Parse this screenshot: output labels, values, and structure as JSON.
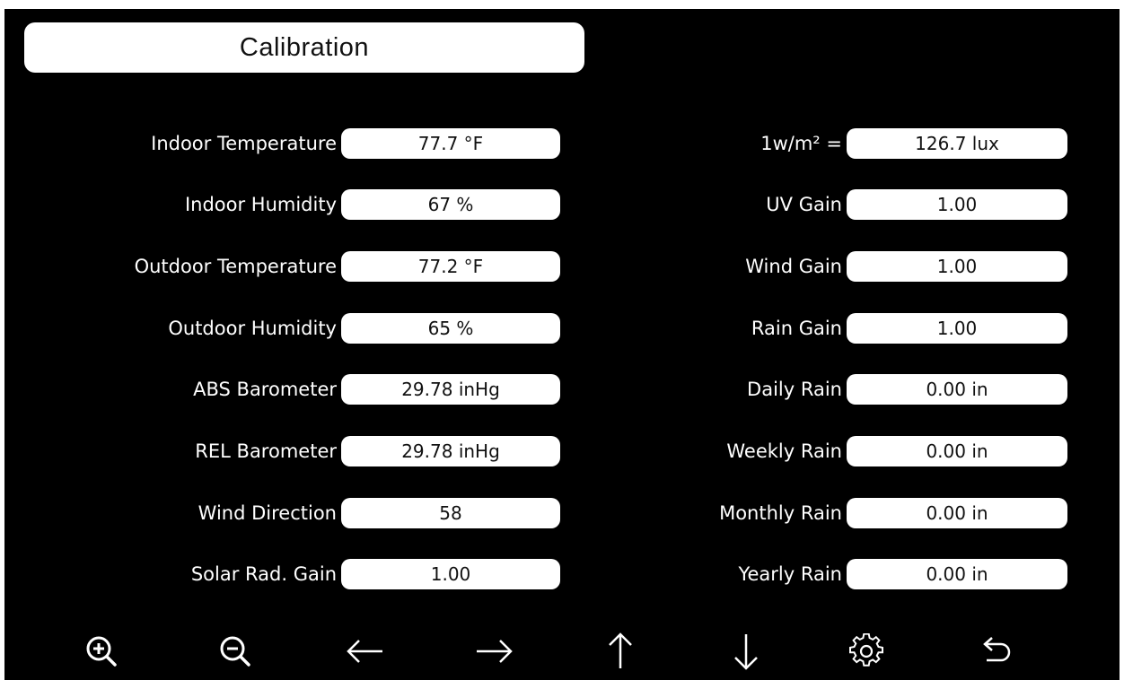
{
  "header": {
    "title": "Calibration"
  },
  "left_fields": [
    {
      "label": "Indoor Temperature",
      "value": "77.7 °F"
    },
    {
      "label": "Indoor Humidity",
      "value": "67 %"
    },
    {
      "label": "Outdoor Temperature",
      "value": "77.2 °F"
    },
    {
      "label": "Outdoor Humidity",
      "value": "65 %"
    },
    {
      "label": "ABS Barometer",
      "value": "29.78 inHg"
    },
    {
      "label": "REL Barometer",
      "value": "29.78 inHg"
    },
    {
      "label": "Wind Direction",
      "value": "58"
    },
    {
      "label": "Solar Rad. Gain",
      "value": "1.00"
    }
  ],
  "right_fields": [
    {
      "label": "1w/m² =",
      "value": "126.7 lux"
    },
    {
      "label": "UV Gain",
      "value": "1.00"
    },
    {
      "label": "Wind Gain",
      "value": "1.00"
    },
    {
      "label": "Rain Gain",
      "value": "1.00"
    },
    {
      "label": "Daily Rain",
      "value": "0.00 in"
    },
    {
      "label": "Weekly Rain",
      "value": "0.00 in"
    },
    {
      "label": "Monthly Rain",
      "value": "0.00 in"
    },
    {
      "label": "Yearly Rain",
      "value": "0.00 in"
    }
  ],
  "toolbar": [
    {
      "icon": "zoom-in-icon"
    },
    {
      "icon": "zoom-out-icon"
    },
    {
      "icon": "arrow-left-icon"
    },
    {
      "icon": "arrow-right-icon"
    },
    {
      "icon": "arrow-up-icon"
    },
    {
      "icon": "arrow-down-icon"
    },
    {
      "icon": "gear-icon"
    },
    {
      "icon": "back-icon"
    }
  ],
  "colors": {
    "background": "#000000",
    "field": "#ffffff",
    "label_text": "#ffffff",
    "value_text": "#111111"
  }
}
